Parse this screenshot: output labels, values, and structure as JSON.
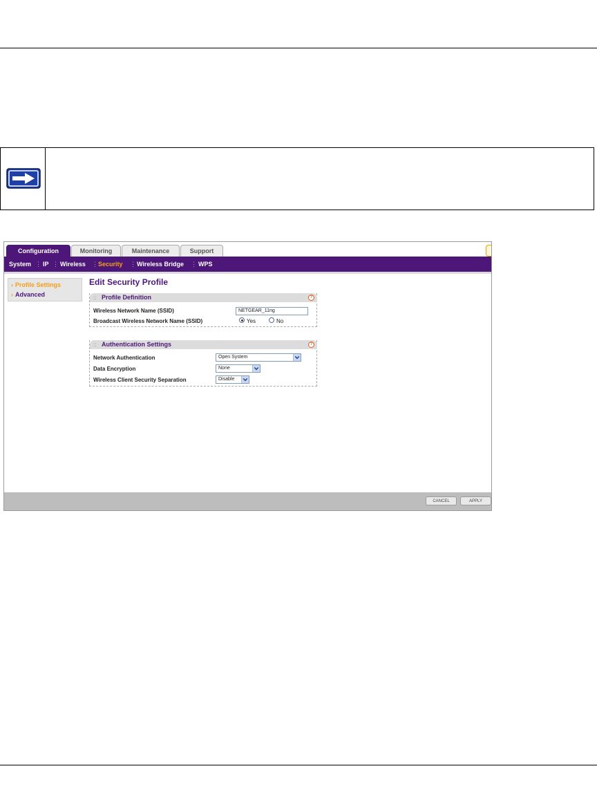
{
  "ui": {
    "tabs": [
      {
        "label": "Configuration",
        "active": true
      },
      {
        "label": "Monitoring",
        "active": false
      },
      {
        "label": "Maintenance",
        "active": false
      },
      {
        "label": "Support",
        "active": false
      }
    ],
    "subnav": [
      {
        "label": "System",
        "active": false
      },
      {
        "label": "IP",
        "active": false
      },
      {
        "label": "Wireless",
        "active": false
      },
      {
        "label": "Security",
        "active": true
      },
      {
        "label": "Wireless Bridge",
        "active": false
      },
      {
        "label": "WPS",
        "active": false
      }
    ],
    "sidebar": [
      {
        "label": "Profile Settings",
        "active": true
      },
      {
        "label": "Advanced",
        "active": false
      }
    ],
    "page_title": "Edit Security Profile",
    "profile_definition": {
      "title": "Profile Definition",
      "ssid_label": "Wireless Network Name (SSID)",
      "ssid_value": "NETGEAR_11ng",
      "broadcast_label": "Broadcast Wireless Network Name (SSID)",
      "yes_label": "Yes",
      "no_label": "No",
      "broadcast_selected": "Yes"
    },
    "authentication_settings": {
      "title": "Authentication Settings",
      "network_auth_label": "Network Authentication",
      "network_auth_value": "Open System",
      "encryption_label": "Data Encryption",
      "encryption_value": "None",
      "separation_label": "Wireless Client Security Separation",
      "separation_value": "Disable"
    },
    "buttons": {
      "cancel": "CANCEL",
      "apply": "APPLY"
    }
  },
  "colors": {
    "brand_purple": "#4c1778",
    "accent_orange": "#f2a01a",
    "footer_gray": "#bdbdbd"
  },
  "icons": {
    "note": "right-arrow-icon"
  }
}
